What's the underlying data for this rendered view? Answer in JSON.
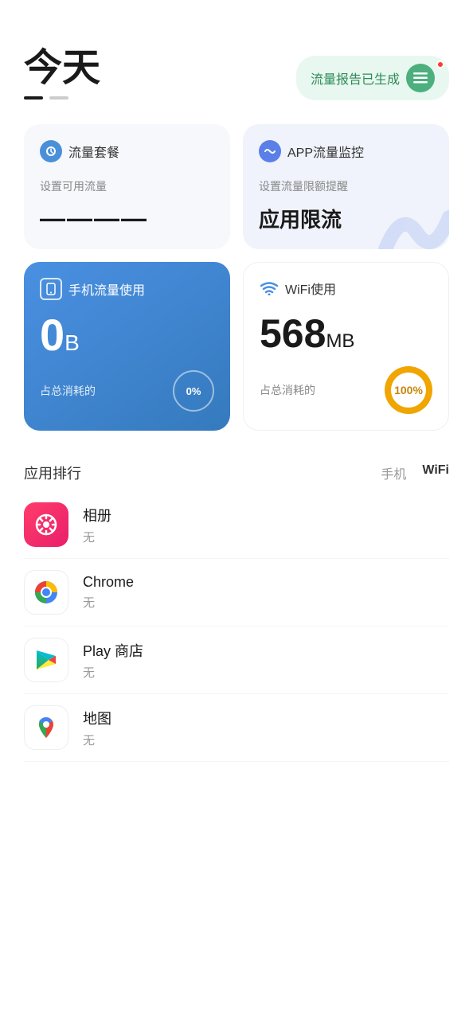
{
  "header": {
    "title": "今天",
    "dots": [
      "active",
      "inactive"
    ],
    "report_button": "流量报告已生成",
    "report_icon": "≡"
  },
  "cards": {
    "flow_package": {
      "title": "流量套餐",
      "subtitle": "设置可用流量",
      "value": "————"
    },
    "app_monitor": {
      "title": "APP流量监控",
      "subtitle": "设置流量限额提醒",
      "limit_text": "应用限流"
    },
    "mobile_usage": {
      "title": "手机流量使用",
      "value": "0",
      "unit": "B",
      "footer_label": "占总消耗的",
      "percent": "0%"
    },
    "wifi_usage": {
      "title": "WiFi使用",
      "value": "568",
      "unit": "MB",
      "footer_label": "占总消耗的",
      "percent": "100%"
    }
  },
  "app_ranking": {
    "section_title": "应用排行",
    "tab_mobile": "手机",
    "tab_wifi": "WiFi",
    "apps": [
      {
        "name": "相册",
        "usage": "无",
        "icon_type": "album"
      },
      {
        "name": "Chrome",
        "usage": "无",
        "icon_type": "chrome"
      },
      {
        "name": "Play 商店",
        "usage": "无",
        "icon_type": "play"
      },
      {
        "name": "地图",
        "usage": "无",
        "icon_type": "maps"
      }
    ]
  }
}
